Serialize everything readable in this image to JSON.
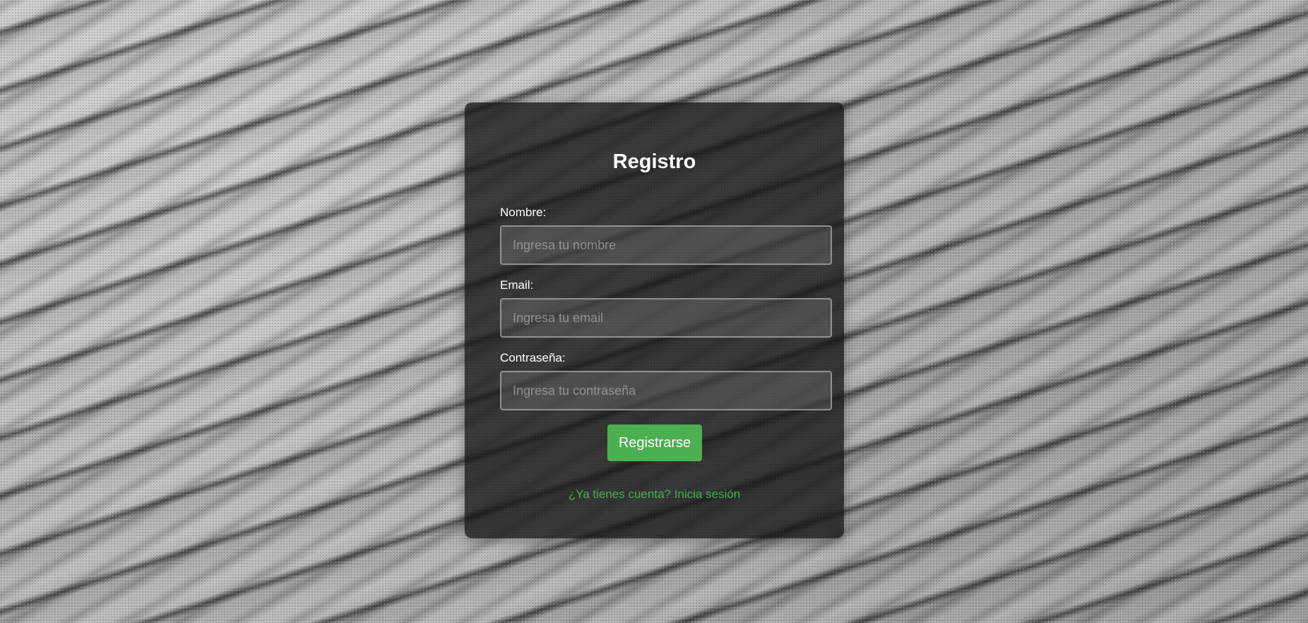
{
  "form": {
    "title": "Registro",
    "fields": [
      {
        "label": "Nombre:",
        "placeholder": "Ingresa tu nombre",
        "value": ""
      },
      {
        "label": "Email:",
        "placeholder": "Ingresa tu email",
        "value": ""
      },
      {
        "label": "Contraseña:",
        "placeholder": "Ingresa tu contraseña",
        "value": ""
      }
    ],
    "submit_label": "Registrarse",
    "login_link_text": "¿Ya tienes cuenta? Inicia sesión"
  },
  "colors": {
    "accent": "#4caf50",
    "card_background": "#141414",
    "text": "#ffffff"
  }
}
